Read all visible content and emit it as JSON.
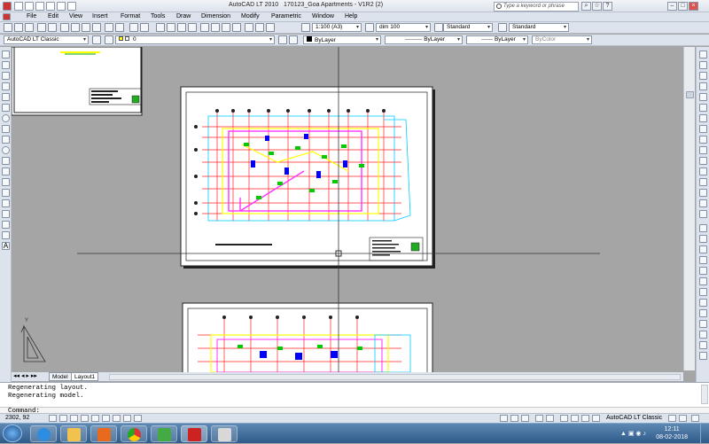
{
  "window": {
    "app_title": "AutoCAD LT 2010",
    "doc_title": "170123_Goa Apartments - V1R2 (2)",
    "search_placeholder": "Type a keyword or phrase"
  },
  "menu": [
    "File",
    "Edit",
    "View",
    "Insert",
    "Format",
    "Tools",
    "Draw",
    "Dimension",
    "Modify",
    "Parametric",
    "Window",
    "Help"
  ],
  "toolbar": {
    "scale": "1:100 (A3)",
    "dim_style": "dim 100",
    "text_style": "Standard",
    "table_style": "Standard",
    "workspace": "AutoCAD LT Classic",
    "layer": "0",
    "color": "ByLayer",
    "linetype": "ByLayer",
    "lineweight": "ByLayer",
    "plotstyle": "ByColor"
  },
  "tabs": [
    "Model",
    "Layout1"
  ],
  "command": {
    "history": [
      "Regenerating layout.",
      "Regenerating model."
    ],
    "prompt": "Command:"
  },
  "status": {
    "coords": "2302, 92",
    "workspace": "AutoCAD LT Classic"
  },
  "taskbar": {
    "time": "12:11",
    "date": "08-02-2018"
  },
  "colors": {
    "chrome": "#dde3ec",
    "canvas": "#a5a5a5",
    "taskbar": "#2f5b8a"
  }
}
